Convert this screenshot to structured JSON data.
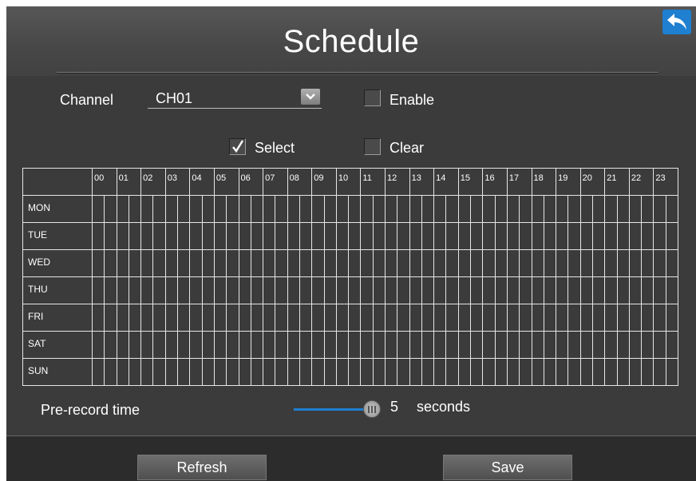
{
  "header": {
    "title": "Schedule",
    "back_icon": "back-arrow-icon"
  },
  "channel": {
    "label": "Channel",
    "value": "CH01"
  },
  "enable": {
    "label": "Enable",
    "checked": false
  },
  "select": {
    "label": "Select",
    "checked": true
  },
  "clear": {
    "label": "Clear",
    "checked": false
  },
  "schedule": {
    "hours": [
      "00",
      "01",
      "02",
      "03",
      "04",
      "05",
      "06",
      "07",
      "08",
      "09",
      "10",
      "11",
      "12",
      "13",
      "14",
      "15",
      "16",
      "17",
      "18",
      "19",
      "20",
      "21",
      "22",
      "23"
    ],
    "days": [
      "MON",
      "TUE",
      "WED",
      "THU",
      "FRI",
      "SAT",
      "SUN"
    ]
  },
  "prerecord": {
    "label": "Pre-record time",
    "value": "5",
    "unit": "seconds"
  },
  "buttons": {
    "refresh": "Refresh",
    "save": "Save"
  },
  "colors": {
    "accent": "#1f7fd0",
    "panel": "#3b3b3b",
    "grid": "#e6e6e6"
  }
}
